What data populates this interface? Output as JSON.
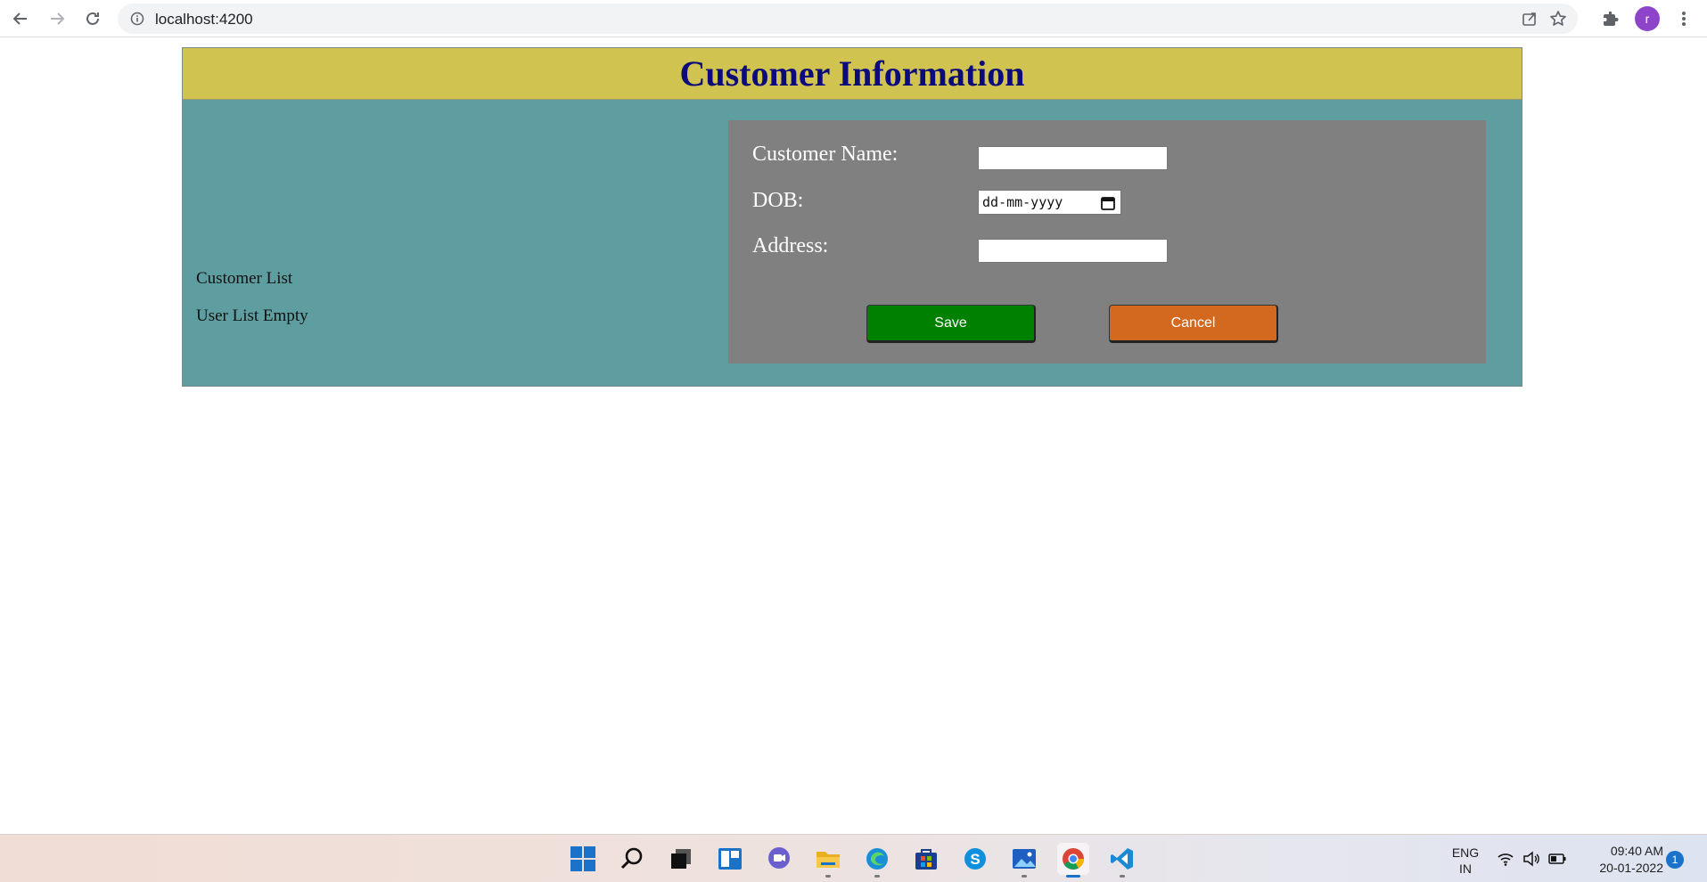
{
  "browser": {
    "url": "localhost:4200",
    "profile_initial": "r",
    "icons": [
      "back-icon",
      "forward-icon",
      "reload-icon",
      "info-icon",
      "share-icon",
      "star-icon",
      "extensions-icon",
      "more-menu-icon"
    ]
  },
  "app": {
    "title": "Customer Information",
    "header_color": "#d0c350",
    "body_color": "#5f9ea0",
    "left": {
      "list_title": "Customer List",
      "empty_message": "User List Empty"
    },
    "form": {
      "name_label": "Customer Name:",
      "name_value": "",
      "dob_label": "DOB:",
      "dob_placeholder": "dd-mm-yyyy",
      "address_label": "Address:",
      "address_value": "",
      "save_label": "Save",
      "cancel_label": "Cancel",
      "save_color": "#008000",
      "cancel_color": "#d2691e"
    }
  },
  "taskbar": {
    "apps": [
      "start-icon",
      "search-icon",
      "task-view-icon",
      "widgets-icon",
      "teams-chat-icon",
      "file-explorer-icon",
      "edge-icon",
      "store-icon",
      "skype-icon",
      "photos-icon",
      "chrome-icon",
      "vscode-icon"
    ],
    "lang_line1": "ENG",
    "lang_line2": "IN",
    "time": "09:40 AM",
    "date": "20-01-2022",
    "notification_count": "1"
  }
}
